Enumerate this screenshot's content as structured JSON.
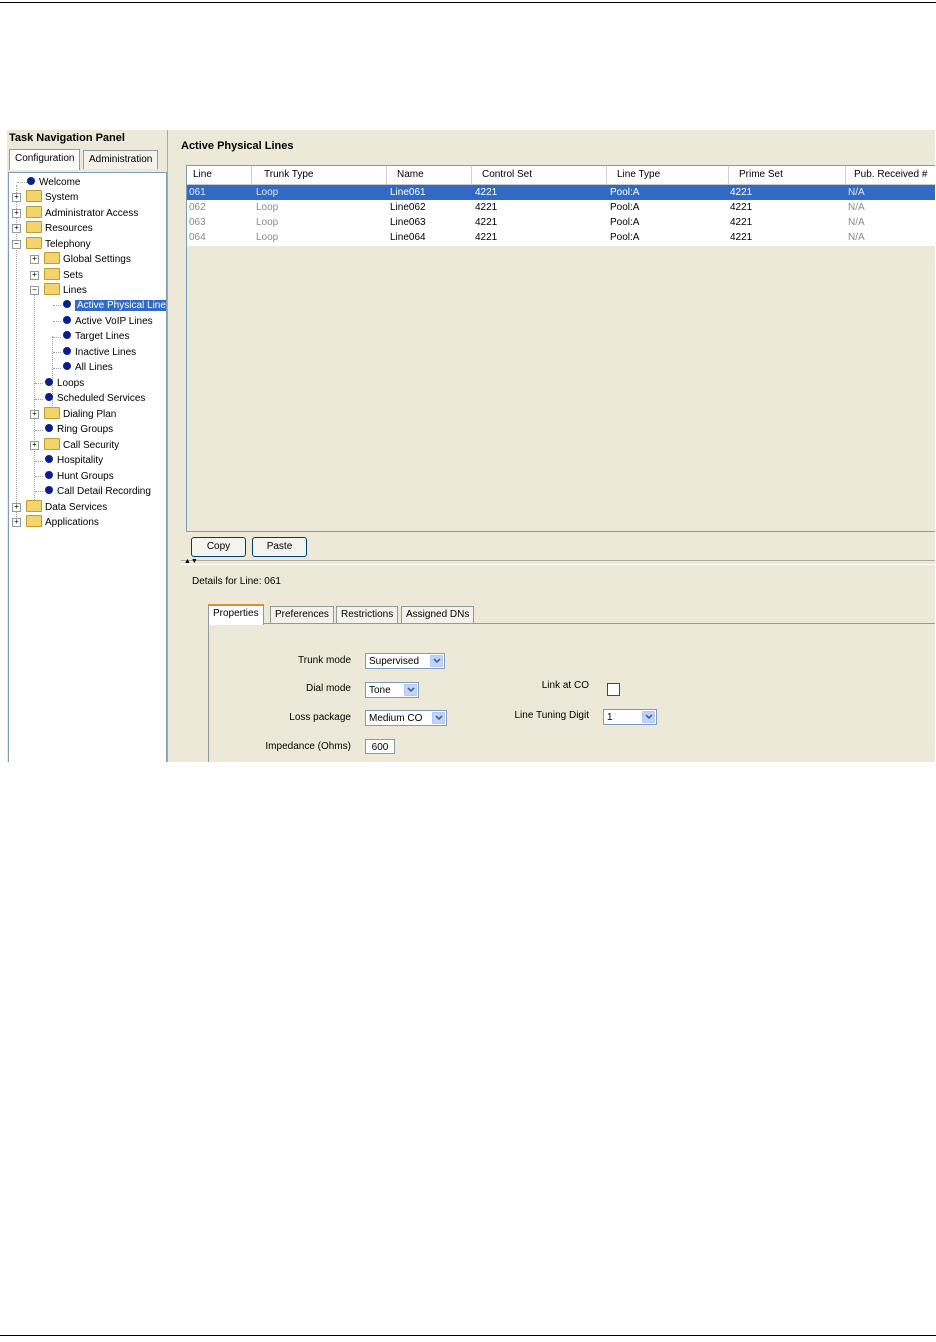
{
  "nav": {
    "title": "Task Navigation Panel",
    "tabs": [
      "Configuration",
      "Administration"
    ],
    "tree": {
      "welcome": "Welcome",
      "system": "System",
      "administrator_access": "Administrator Access",
      "resources": "Resources",
      "telephony": "Telephony",
      "global_settings": "Global Settings",
      "sets": "Sets",
      "lines": "Lines",
      "active_physical_lines": "Active Physical Line",
      "active_voip_lines": "Active VoIP Lines",
      "target_lines": "Target Lines",
      "inactive_lines": "Inactive Lines",
      "all_lines": "All Lines",
      "loops": "Loops",
      "scheduled_services": "Scheduled Services",
      "dialing_plan": "Dialing Plan",
      "ring_groups": "Ring Groups",
      "call_security": "Call Security",
      "hospitality": "Hospitality",
      "hunt_groups": "Hunt Groups",
      "call_detail_recording": "Call Detail Recording",
      "data_services": "Data Services",
      "applications": "Applications"
    }
  },
  "main": {
    "title": "Active Physical Lines",
    "columns": [
      "Line",
      "Trunk Type",
      "Name",
      "Control Set",
      "Line Type",
      "Prime Set",
      "Pub. Received #"
    ],
    "rows": [
      [
        "061",
        "Loop",
        "Line061",
        "4221",
        "Pool:A",
        "4221",
        "N/A"
      ],
      [
        "062",
        "Loop",
        "Line062",
        "4221",
        "Pool:A",
        "4221",
        "N/A"
      ],
      [
        "063",
        "Loop",
        "Line063",
        "4221",
        "Pool:A",
        "4221",
        "N/A"
      ],
      [
        "064",
        "Loop",
        "Line064",
        "4221",
        "Pool:A",
        "4221",
        "N/A"
      ]
    ],
    "copy_label": "Copy",
    "paste_label": "Paste"
  },
  "details": {
    "label": "Details for Line: 061",
    "tabs": [
      "Properties",
      "Preferences",
      "Restrictions",
      "Assigned DNs"
    ],
    "trunk_mode_label": "Trunk mode",
    "trunk_mode_value": "Supervised",
    "dial_mode_label": "Dial mode",
    "dial_mode_value": "Tone",
    "loss_package_label": "Loss package",
    "loss_package_value": "Medium CO",
    "impedance_label": "Impedance (Ohms)",
    "impedance_value": "600",
    "link_at_co_label": "Link at CO",
    "line_tuning_label": "Line Tuning Digit",
    "line_tuning_value": "1"
  }
}
